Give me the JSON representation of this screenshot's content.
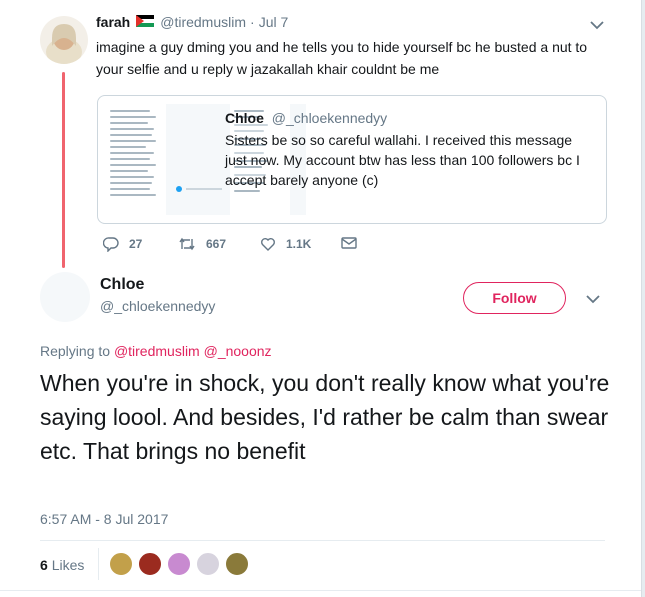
{
  "top_tweet": {
    "display_name": "farah",
    "handle": "@tiredmuslim",
    "date": "Jul 7",
    "text": "imagine a guy dming you and he tells you to hide yourself bc he busted a nut to your selfie and u reply w jazakallah khair couldnt be me",
    "quoted": {
      "name": "Chloe",
      "handle": "@_chloekennedyy",
      "text": "Sisters be so so careful wallahi. I received this message just now. My account btw has less than 100 followers bc I accept barely anyone (c)"
    },
    "actions": {
      "replies": "27",
      "retweets": "667",
      "likes": "1.1K"
    }
  },
  "main_tweet": {
    "display_name": "Chloe",
    "handle": "@_chloekennedyy",
    "follow_label": "Follow",
    "replying_prefix": "Replying to",
    "replying_to": [
      "@tiredmuslim",
      "@_nooonz"
    ],
    "text": "When you're in shock, you don't really know what you're saying loool. And besides, I'd rather be calm than swear etc. That brings no benefit",
    "timestamp": "6:57 AM - 8 Jul 2017",
    "likes_count": "6",
    "likes_label": "Likes"
  },
  "colors": {
    "accent_red": "#e0245e",
    "link_red": "#e0245e",
    "thread_line": "#f0646e",
    "muted": "#657786"
  },
  "icons": [
    "palestine-flag-icon",
    "chevron-down-icon",
    "reply-icon",
    "retweet-icon",
    "like-icon",
    "dm-icon"
  ]
}
